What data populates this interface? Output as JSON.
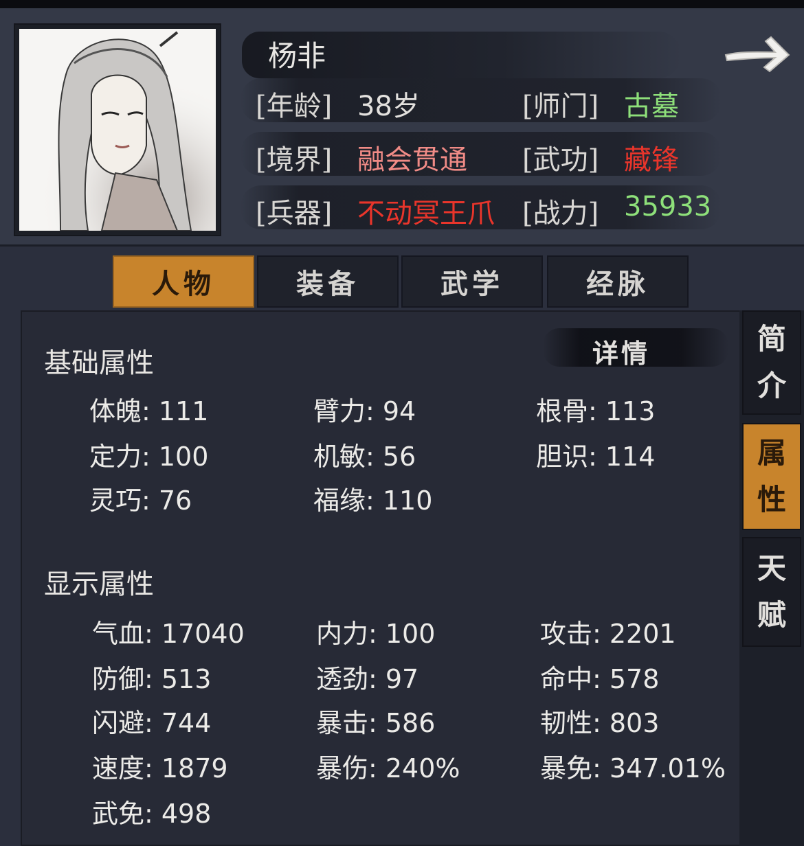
{
  "character": {
    "name": "杨非",
    "info": [
      {
        "label": "[年龄]",
        "value": "38岁"
      },
      {
        "label": "[师门]",
        "value": "古墓"
      },
      {
        "label": "[境界]",
        "value": "融会贯通"
      },
      {
        "label": "[武功]",
        "value": "藏锋"
      },
      {
        "label": "[兵器]",
        "value": "不动冥王爪"
      },
      {
        "label": "[战力]",
        "value": "35933"
      }
    ]
  },
  "nav": {
    "next_icon": "right-arrow-icon"
  },
  "tabs": [
    {
      "label": "人物",
      "active": true
    },
    {
      "label": "装备",
      "active": false
    },
    {
      "label": "武学",
      "active": false
    },
    {
      "label": "经脉",
      "active": false
    }
  ],
  "side_tabs": [
    {
      "chars": [
        "简",
        "介"
      ],
      "active": false
    },
    {
      "chars": [
        "属",
        "性"
      ],
      "active": true
    },
    {
      "chars": [
        "天",
        "赋"
      ],
      "active": false
    }
  ],
  "detail_label": "详情",
  "basic": {
    "title": "基础属性",
    "stats": [
      "体魄: 111",
      "臂力: 94",
      "根骨: 113",
      "定力: 100",
      "机敏: 56",
      "胆识: 114",
      "灵巧: 76",
      "福缘: 110"
    ]
  },
  "display": {
    "title": "显示属性",
    "stats": [
      "气血: 17040",
      "内力: 100",
      "攻击: 2201",
      "防御: 513",
      "透劲: 97",
      "命中: 578",
      "闪避: 744",
      "暴击: 586",
      "韧性: 803",
      "速度: 1879",
      "暴伤: 240%",
      "暴免: 347.01%",
      "武免: 498"
    ]
  },
  "colors": {
    "accent": "#c8842c",
    "green": "#8ee07a",
    "pink": "#f08b86",
    "red": "#e9352b",
    "panel": "#272a36"
  }
}
